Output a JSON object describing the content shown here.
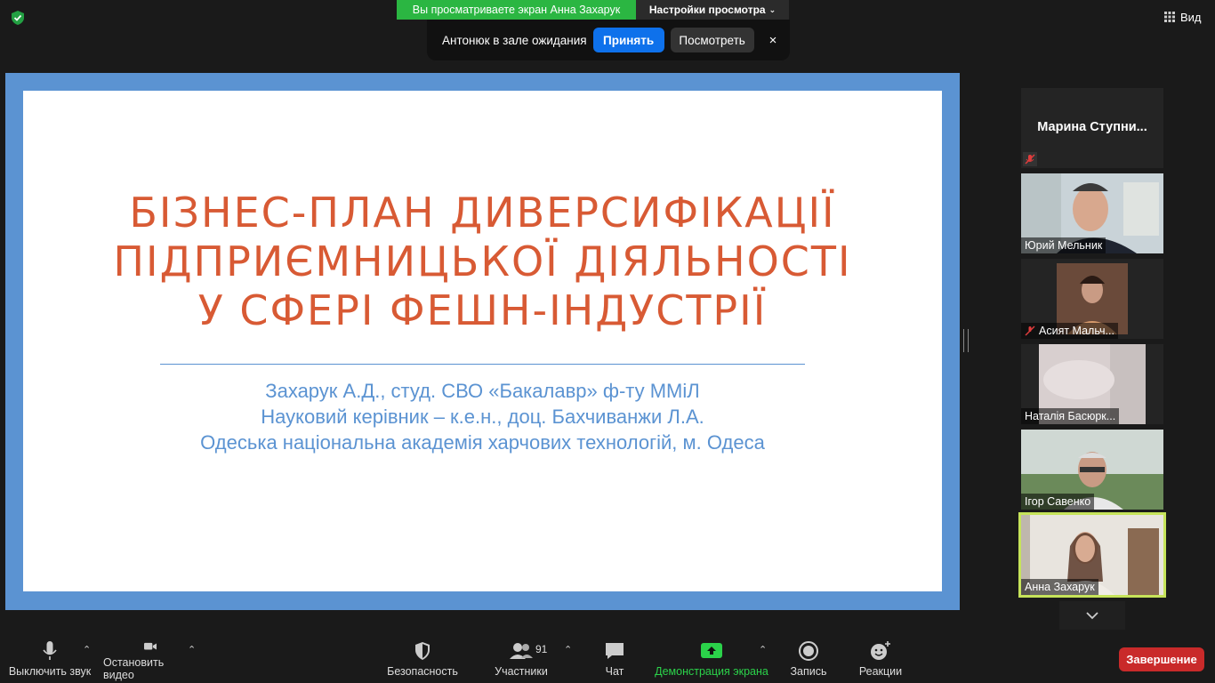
{
  "top": {
    "viewing_banner": "Вы просматриваете экран Анна Захарук",
    "view_settings": "Настройки просмотра",
    "view_button": "Вид"
  },
  "waiting_popup": {
    "message": "Антонюк в зале ожидания",
    "admit": "Принять",
    "see": "Посмотреть",
    "close": "×"
  },
  "slide": {
    "title_lines": [
      "БІЗНЕС-ПЛАН ДИВЕРСИФІКАЦІЇ",
      "ПІДПРИЄМНИЦЬКОЇ ДІЯЛЬНОСТІ",
      "У СФЕРІ ФЕШН-ІНДУСТРІЇ"
    ],
    "subtitle_lines": [
      "Захарук А.Д., студ. СВО «Бакалавр» ф-ту ММіЛ",
      "Науковий керівник – к.е.н., доц. Бахчиванжи Л.А.",
      "Одеська національна академія харчових технологій, м. Одеса"
    ],
    "title_color": "#d85a34",
    "subtitle_color": "#5b93d2"
  },
  "participants": [
    {
      "name": "Марина   Ступни...",
      "muted": true,
      "video": false
    },
    {
      "name": "Юрий Мельник",
      "muted": false,
      "video": true
    },
    {
      "name": "Асият Мальч...",
      "muted": true,
      "video": true
    },
    {
      "name": "Наталія Басюрк...",
      "muted": false,
      "video": true
    },
    {
      "name": "Ігор Савенко",
      "muted": false,
      "video": true
    },
    {
      "name": "Анна Захарук",
      "muted": false,
      "video": true,
      "active_speaker": true
    }
  ],
  "toolbar": {
    "mute": "Выключить звук",
    "stop_video": "Остановить видео",
    "security": "Безопасность",
    "participants": "Участники",
    "participants_count": "91",
    "chat": "Чат",
    "share": "Демонстрация экрана",
    "record": "Запись",
    "reactions": "Реакции",
    "end": "Завершение"
  },
  "colors": {
    "accent_blue": "#0e71eb",
    "share_green": "#2bd24a",
    "end_red": "#c92a2a",
    "speaker_outline": "#c6e35a"
  }
}
